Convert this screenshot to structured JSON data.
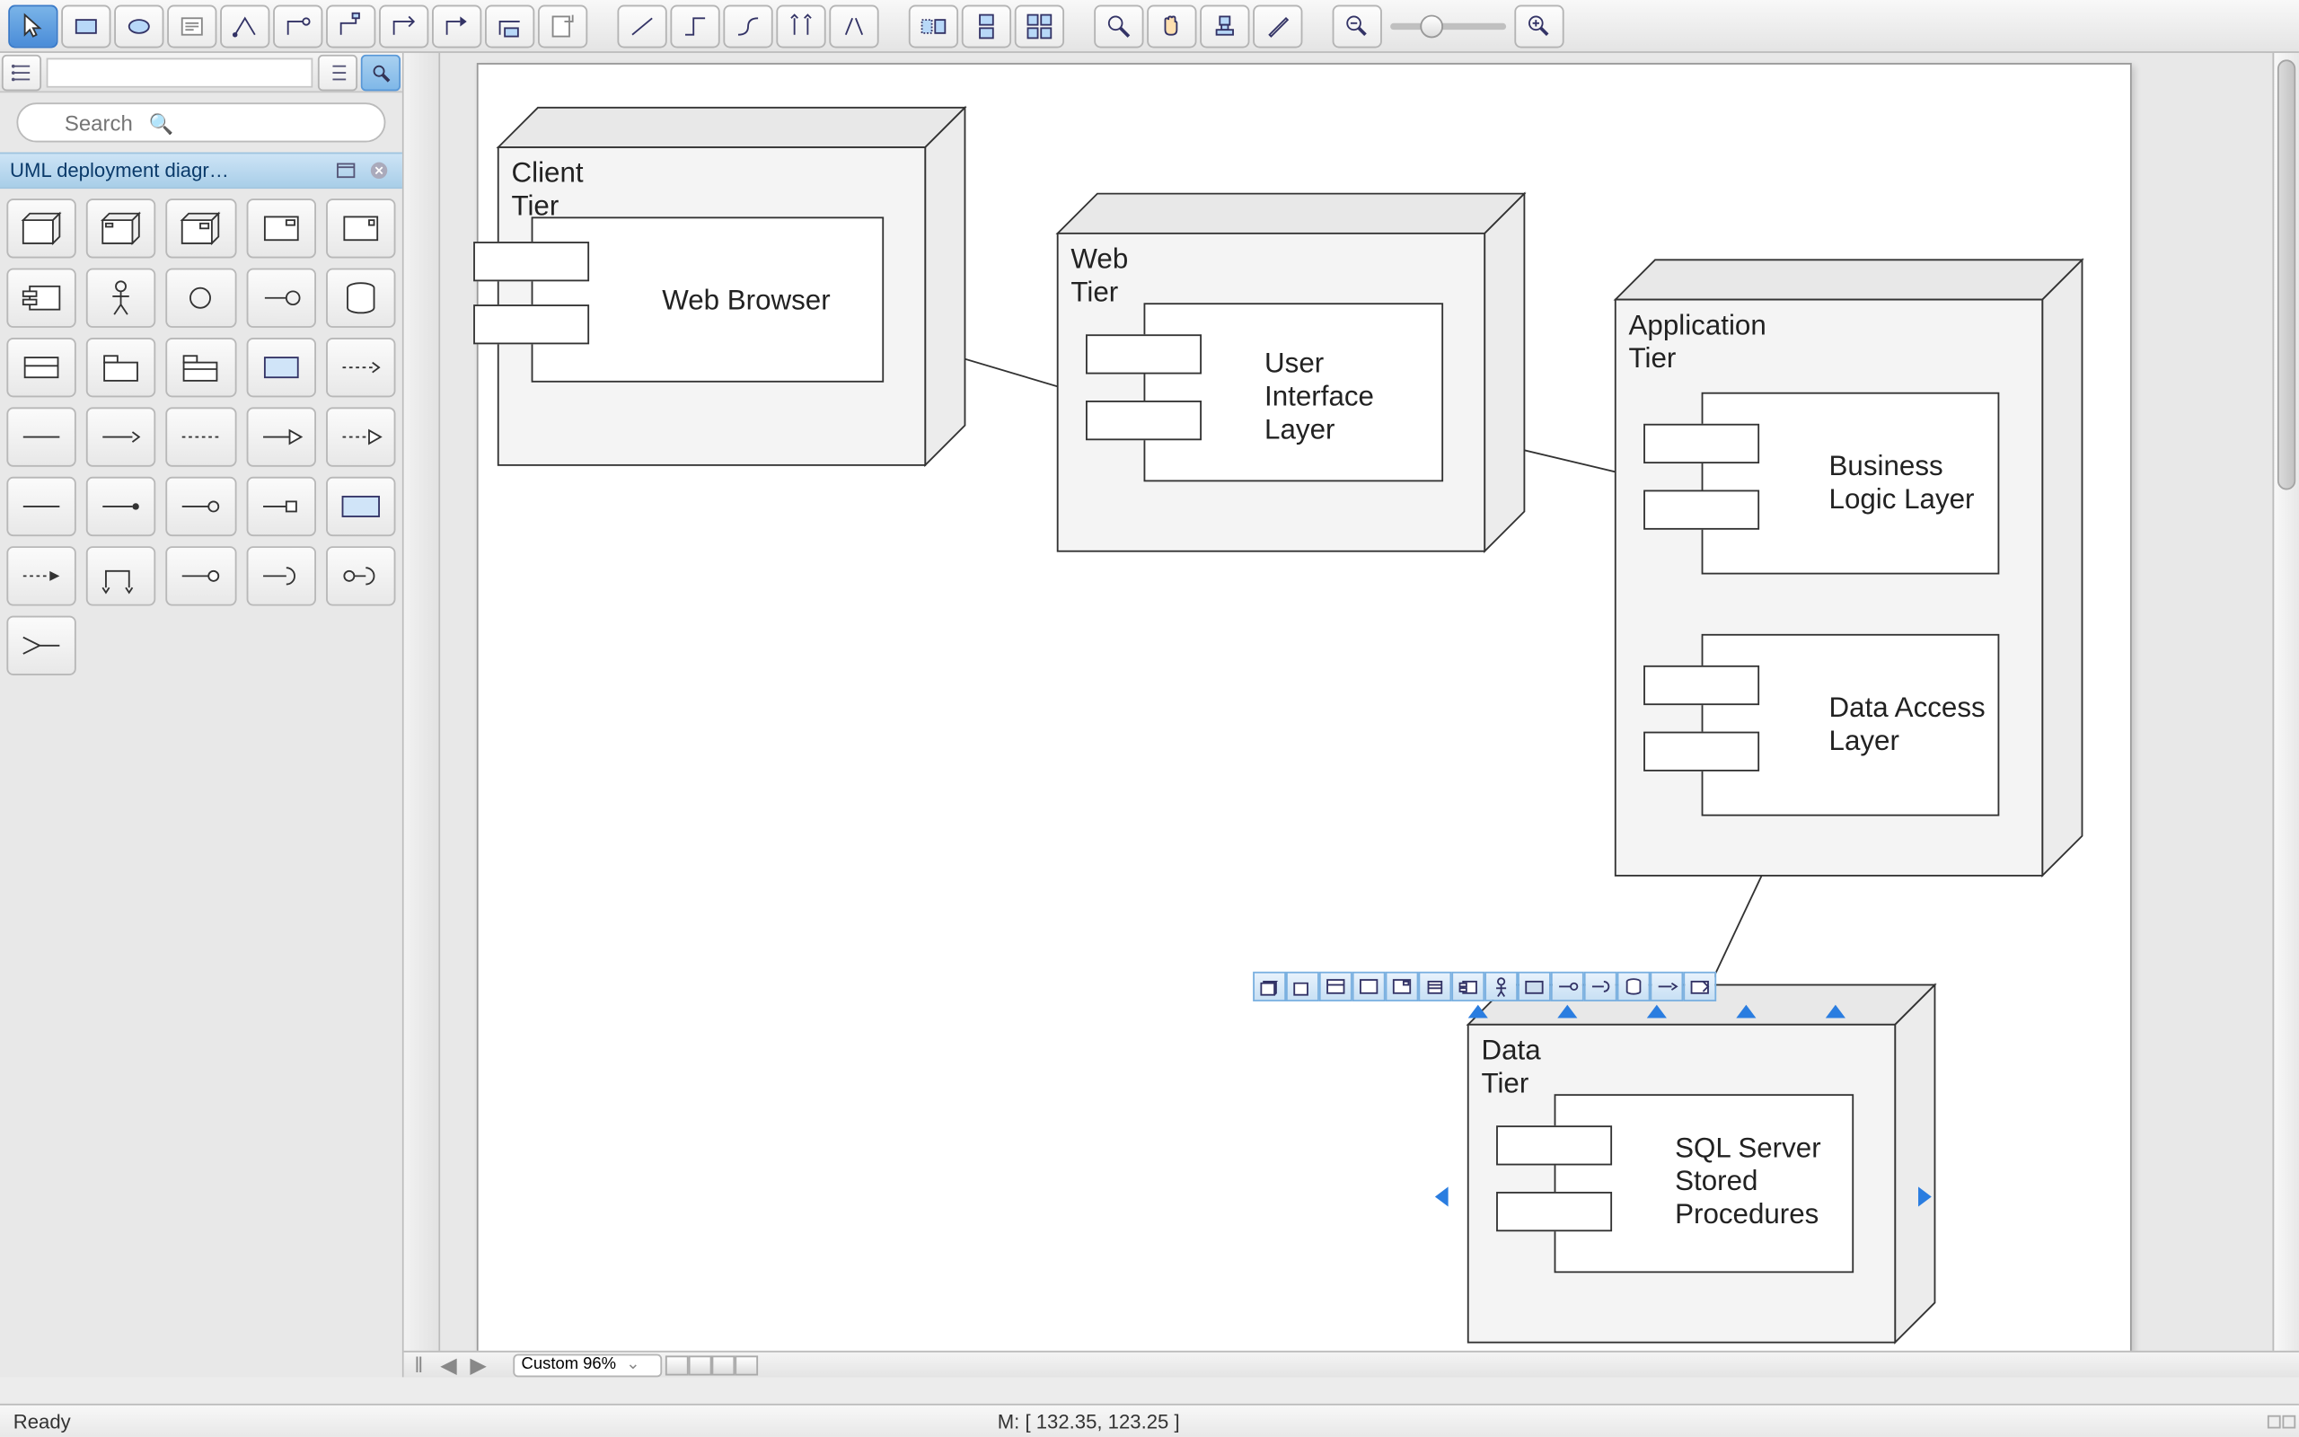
{
  "toolbar": {
    "groups": [
      [
        "pointer",
        "rect",
        "ellipse",
        "text",
        "anchor1",
        "anchor2",
        "anchor3",
        "anchor4",
        "anchor5",
        "anchor6",
        "export"
      ],
      [
        "line1",
        "line2",
        "line3",
        "line4",
        "line5"
      ],
      [
        "group1",
        "group2",
        "group3"
      ],
      [
        "zoom-tool",
        "pan",
        "stamp",
        "eyedropper"
      ]
    ],
    "zoom_out": "−",
    "zoom_in": "+"
  },
  "sidebar": {
    "search_placeholder": "Search",
    "category_title": "UML deployment diagr…",
    "palette_count": 31
  },
  "diagram": {
    "nodes": [
      {
        "id": "client",
        "title": "Client Tier",
        "component": "Web Browser"
      },
      {
        "id": "web",
        "title": "Web Tier",
        "component": "User Interface Layer"
      },
      {
        "id": "app",
        "title": "Application Tier",
        "components": [
          "Business Logic Layer",
          "Data Access Layer"
        ]
      },
      {
        "id": "data",
        "title": "Data Tier",
        "component": "SQL Server Stored Procedures"
      }
    ]
  },
  "scrollbar": {
    "zoom_label": "Custom 96%"
  },
  "status": {
    "ready": "Ready",
    "coords": "M: [ 132.35, 123.25 ]"
  }
}
